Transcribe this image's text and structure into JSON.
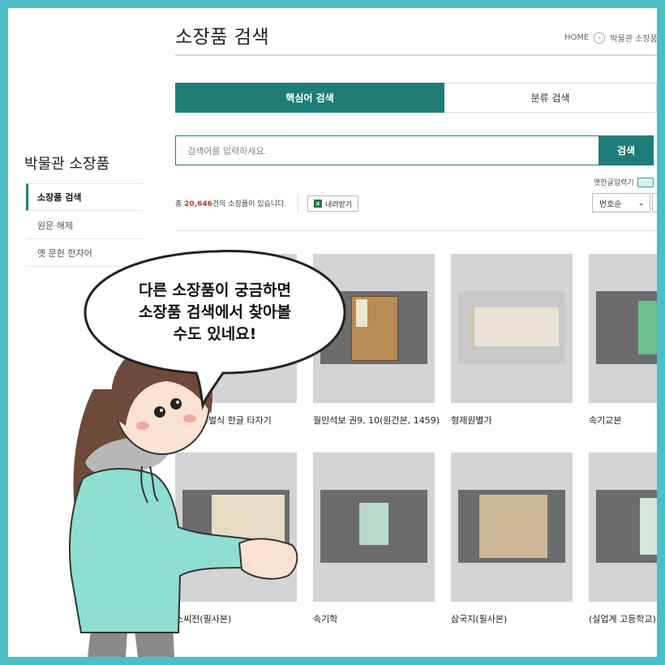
{
  "page": {
    "title": "소장품 검색",
    "breadcrumb": {
      "home": "HOME",
      "current": "박물관 소장품"
    }
  },
  "sidebar": {
    "title": "박물관 소장품",
    "items": [
      {
        "label": "소장품 검색",
        "active": true
      },
      {
        "label": "원문 해제",
        "active": false
      },
      {
        "label": "옛 문헌 한자어",
        "active": false
      }
    ]
  },
  "tabs": [
    {
      "label": "핵심어 검색",
      "active": true
    },
    {
      "label": "분류 검색",
      "active": false
    }
  ],
  "search": {
    "placeholder": "검색어를 입력하세요.",
    "button": "검색"
  },
  "ime_label": "옛한글입력기",
  "results": {
    "prefix": "총 ",
    "count": "20,646",
    "suffix": "건의 소장품이 있습니다."
  },
  "download_label": "내려받기",
  "sort": {
    "selected": "번호순"
  },
  "items": [
    {
      "caption": "송기주 4벌식 한글 타자기"
    },
    {
      "caption": "월인석보 권9, 10(원간본, 1459)"
    },
    {
      "caption": "형제원별가"
    },
    {
      "caption": "속기교본"
    },
    {
      "caption": "소씨전(필사본)"
    },
    {
      "caption": "속기학"
    },
    {
      "caption": "삼국지(필사본)"
    },
    {
      "caption": "(실업계 고등학교) 속"
    }
  ],
  "speech_bubble": {
    "line1": "다른 소장품이 궁금하면",
    "line2": "소장품 검색에서 찾아볼",
    "line3": "수도 있네요!"
  },
  "colors": {
    "brand": "#1e7d78",
    "border": "#4bbfc5",
    "count": "#c0392b",
    "hoodie": "#8fded2"
  }
}
